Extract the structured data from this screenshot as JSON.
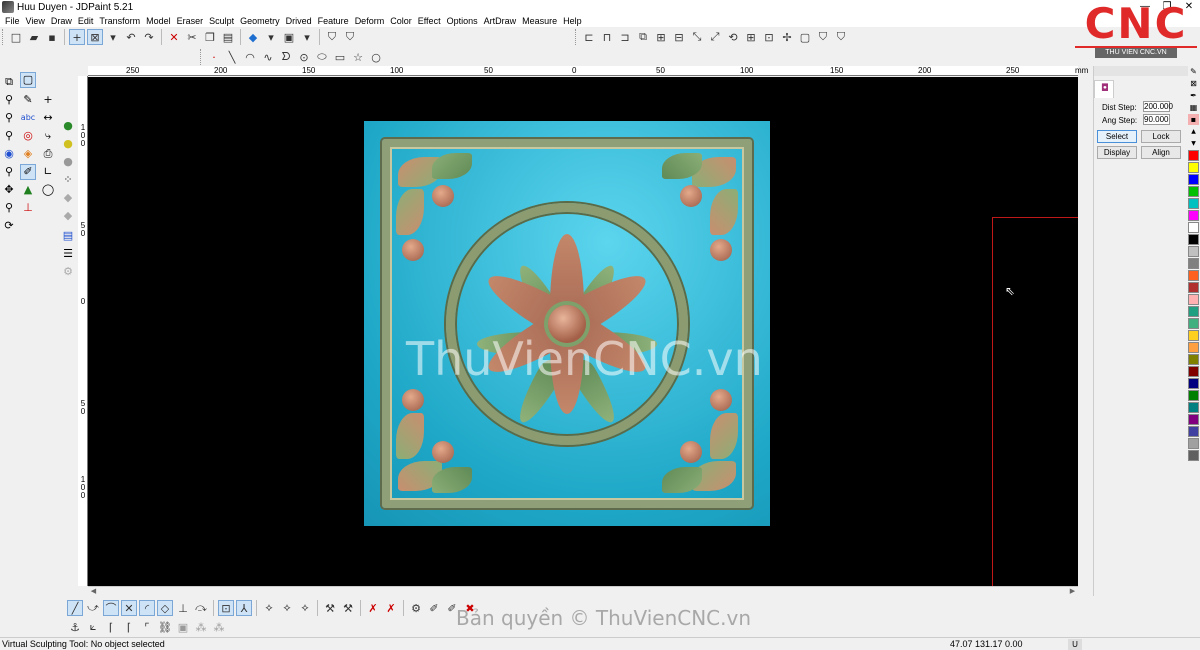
{
  "window": {
    "title": "Huu Duyen - JDPaint 5.21",
    "controls": [
      "—",
      "❐",
      "✕"
    ]
  },
  "menu": [
    "File",
    "View",
    "Draw",
    "Edit",
    "Transform",
    "Model",
    "Eraser",
    "Sculpt",
    "Geometry",
    "Drived",
    "Feature",
    "Deform",
    "Color",
    "Effect",
    "Options",
    "ArtDraw",
    "Measure",
    "Help"
  ],
  "logo": {
    "text": "CNC",
    "subtitle": "THU VIEN CNC.VN"
  },
  "ruler": {
    "unit": "mm",
    "top_labels": [
      "250",
      "200",
      "150",
      "100",
      "50",
      "0",
      "50",
      "100",
      "150",
      "200",
      "250"
    ],
    "left_labels": [
      "100",
      "50",
      "0",
      "50",
      "100"
    ]
  },
  "viewport": {
    "watermark": "ThuVienCNC.vn"
  },
  "panel": {
    "dist_step_label": "Dist Step:",
    "dist_step_value": "200.000",
    "ang_step_label": "Ang Step:",
    "ang_step_value": "90.000",
    "select_label": "Select",
    "lock_label": "Lock",
    "display_label": "Display",
    "align_label": "Align"
  },
  "palette_colors": [
    "#ff0000",
    "#ffff00",
    "#0000ff",
    "#00c000",
    "#00c0c0",
    "#ff00ff",
    "#ffffff",
    "#000000",
    "#c0c0c0",
    "#808080",
    "#ff6020",
    "#b03030",
    "#ffb0b0",
    "#20a080",
    "#40b080",
    "#ffd020",
    "#ffa040",
    "#808000",
    "#800000",
    "#000080",
    "#008000",
    "#008080",
    "#800080",
    "#4040a0",
    "#a0a0a0",
    "#606060"
  ],
  "copyright": "Bản quyền © ThuVienCNC.vn",
  "status": {
    "message": "Virtual Sculpting Tool: No object selected",
    "coords": "47.07 131.17 0.00",
    "unit": "U"
  }
}
